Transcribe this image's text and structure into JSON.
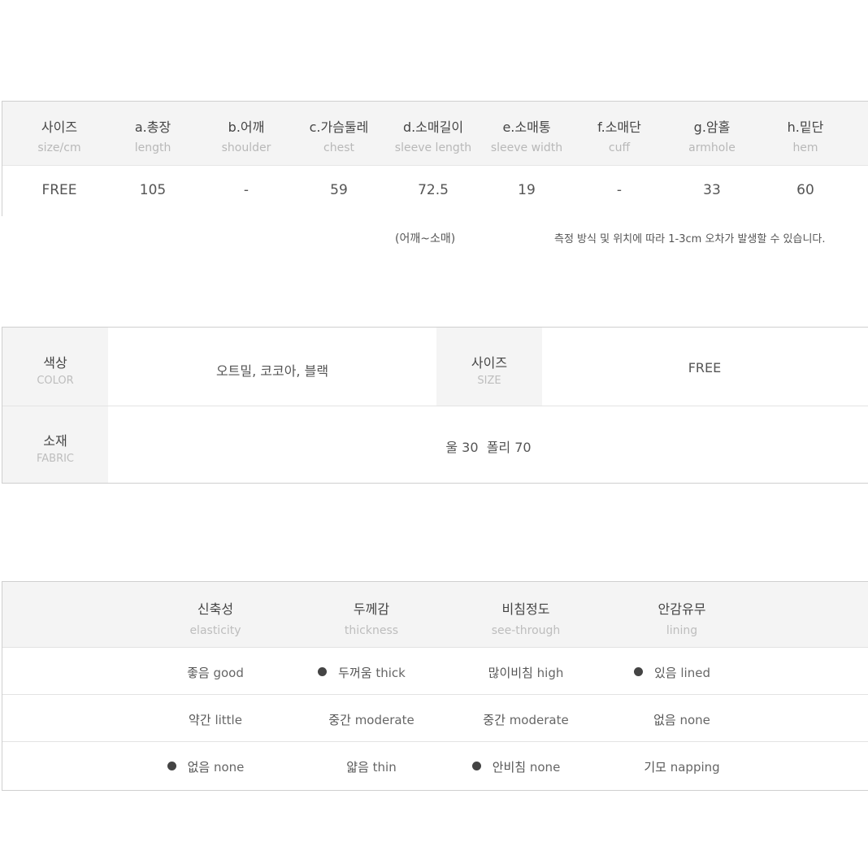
{
  "size_table": {
    "headers": [
      {
        "ko": "사이즈",
        "en": "size/cm"
      },
      {
        "ko": "a.총장",
        "en": "length"
      },
      {
        "ko": "b.어깨",
        "en": "shoulder"
      },
      {
        "ko": "c.가슴둘레",
        "en": "chest"
      },
      {
        "ko": "d.소매길이",
        "en": "sleeve length"
      },
      {
        "ko": "e.소매통",
        "en": "sleeve width"
      },
      {
        "ko": "f.소매단",
        "en": "cuff"
      },
      {
        "ko": "g.암홀",
        "en": "armhole"
      },
      {
        "ko": "h.밑단",
        "en": "hem"
      }
    ],
    "values": [
      "FREE",
      "105",
      "-",
      "59",
      "72.5",
      "19",
      "-",
      "33",
      "60"
    ],
    "note_sleeve": "(어깨~소매)",
    "note_error": "측정 방식 및 위치에 따라 1-3cm 오차가 발생할 수 있습니다."
  },
  "info_table": {
    "color_label": {
      "ko": "색상",
      "en": "COLOR"
    },
    "color_value": "오트밀, 코코아, 블랙",
    "size_label": {
      "ko": "사이즈",
      "en": "SIZE"
    },
    "size_value": "FREE",
    "fabric_label": {
      "ko": "소재",
      "en": "FABRIC"
    },
    "fabric_value": "울 30  폴리 70"
  },
  "feature_table": {
    "headers": [
      {
        "ko": "신축성",
        "en": "elasticity"
      },
      {
        "ko": "두께감",
        "en": "thickness"
      },
      {
        "ko": "비침정도",
        "en": "see-through"
      },
      {
        "ko": "안감유무",
        "en": "lining"
      }
    ],
    "rows": [
      [
        {
          "ko": "좋음",
          "en": "good",
          "selected": false
        },
        {
          "ko": "두꺼움",
          "en": "thick",
          "selected": true
        },
        {
          "ko": "많이비침",
          "en": "high",
          "selected": false
        },
        {
          "ko": "있음",
          "en": "lined",
          "selected": true
        }
      ],
      [
        {
          "ko": "약간",
          "en": "little",
          "selected": false
        },
        {
          "ko": "중간",
          "en": "moderate",
          "selected": false
        },
        {
          "ko": "중간",
          "en": "moderate",
          "selected": false
        },
        {
          "ko": "없음",
          "en": "none",
          "selected": false
        }
      ],
      [
        {
          "ko": "없음",
          "en": "none",
          "selected": true
        },
        {
          "ko": "얇음",
          "en": "thin",
          "selected": false
        },
        {
          "ko": "안비침",
          "en": "none",
          "selected": true
        },
        {
          "ko": "기모",
          "en": "napping",
          "selected": false
        }
      ]
    ]
  }
}
